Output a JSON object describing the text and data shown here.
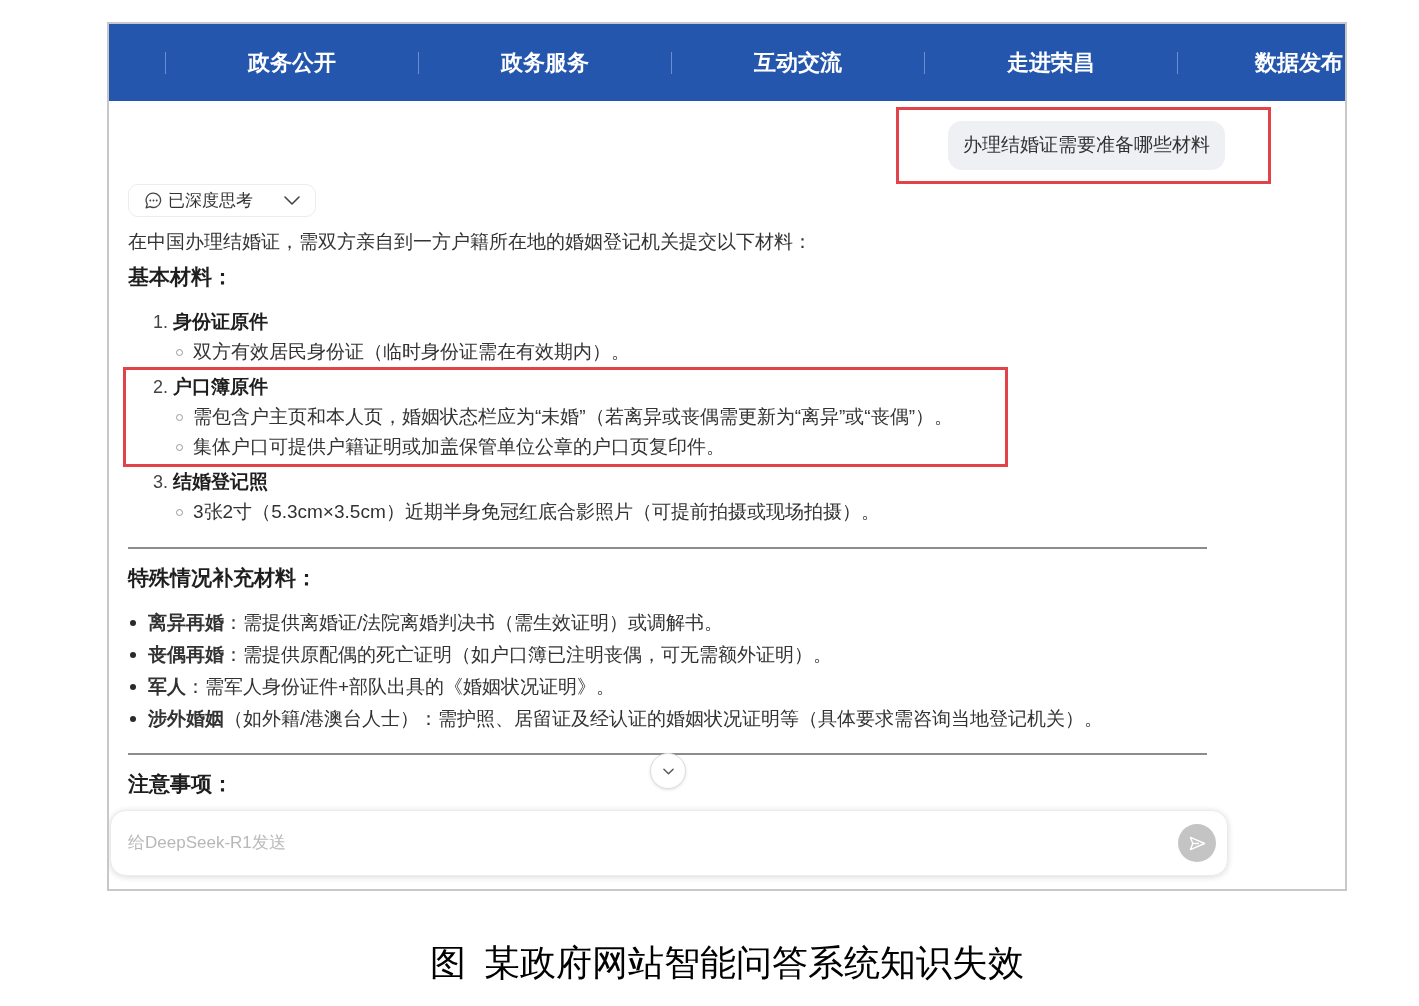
{
  "nav": [
    "政务公开",
    "政务服务",
    "互动交流",
    "走进荣昌",
    "数据发布"
  ],
  "chat": {
    "user_message": {
      "text": "办理结婚证需要准备哪些材料",
      "highlighted": true
    },
    "thinking_toggle": {
      "label": "已深度思考",
      "expanded": false
    },
    "answer": {
      "intro": "在中国办理结婚证，需双方亲自到一方户籍所在地的婚姻登记机关提交以下材料：",
      "sections": [
        {
          "kind": "numbered",
          "heading": "基本材料：",
          "items": [
            {
              "number": "1.",
              "title": "身份证原件",
              "highlighted": false,
              "children": [
                "双方有效居民身份证（临时身份证需在有效期内）。"
              ]
            },
            {
              "number": "2.",
              "title": "户口簿原件",
              "highlighted": true,
              "children": [
                "需包含户主页和本人页，婚姻状态栏应为“未婚”（若离异或丧偶需更新为“离异”或“丧偶”）。",
                "集体户口可提供户籍证明或加盖保管单位公章的户口页复印件。"
              ]
            },
            {
              "number": "3.",
              "title": "结婚登记照",
              "highlighted": false,
              "children": [
                "3张2寸（5.3cm×3.5cm）近期半身免冠红底合影照片（可提前拍摄或现场拍摄）。"
              ]
            }
          ]
        },
        {
          "kind": "bulleted",
          "heading": "特殊情况补充材料：",
          "items": [
            "**离异再婚**：需提供离婚证/法院离婚判决书（需生效证明）或调解书。",
            "**丧偶再婚**：需提供原配偶的死亡证明（如户口簿已注明丧偶，可无需额外证明）。",
            "**军人**：需军人身份证件+部队出具的《婚姻状况证明》。",
            "**涉外婚姻**（如外籍/港澳台人士）：需护照、居留证及经认证的婚姻状况证明等（具体要求需咨询当地登记机关）。"
          ]
        },
        {
          "kind": "bulleted",
          "heading": "注意事项："
        }
      ]
    },
    "input": {
      "placeholder": "给DeepSeek-R1发送"
    }
  },
  "caption": "图  某政府网站智能问答系统知识失效"
}
